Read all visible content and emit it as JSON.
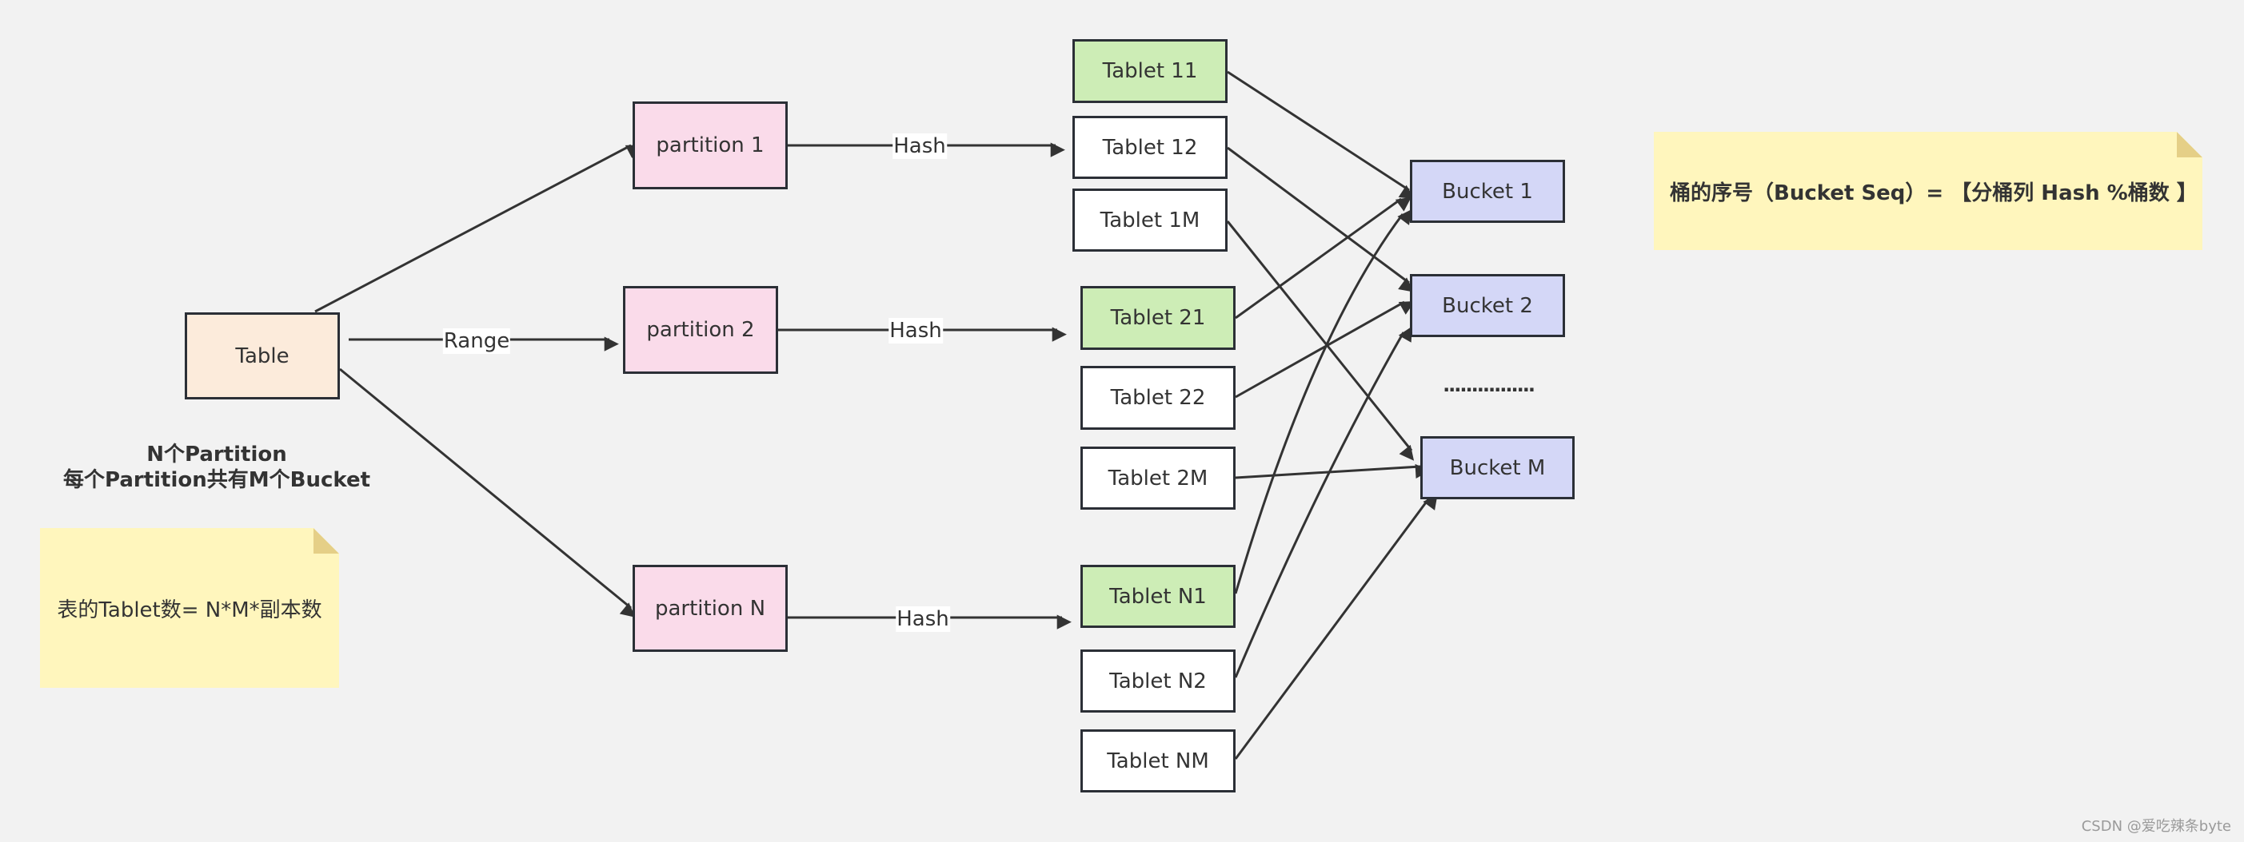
{
  "diagram": {
    "nodes": {
      "table": {
        "label": "Table",
        "kind": "table"
      },
      "partition_1": {
        "label": "partition 1",
        "kind": "partition"
      },
      "partition_2": {
        "label": "partition 2",
        "kind": "partition"
      },
      "partition_n": {
        "label": "partition N",
        "kind": "partition"
      },
      "tablet_11": {
        "label": "Tablet 11",
        "kind": "tablet",
        "primary": true
      },
      "tablet_12": {
        "label": "Tablet 12",
        "kind": "tablet",
        "primary": false
      },
      "tablet_1m": {
        "label": "Tablet 1M",
        "kind": "tablet",
        "primary": false
      },
      "tablet_21": {
        "label": "Tablet 21",
        "kind": "tablet",
        "primary": true
      },
      "tablet_22": {
        "label": "Tablet 22",
        "kind": "tablet",
        "primary": false
      },
      "tablet_2m": {
        "label": "Tablet 2M",
        "kind": "tablet",
        "primary": false
      },
      "tablet_n1": {
        "label": "Tablet N1",
        "kind": "tablet",
        "primary": true
      },
      "tablet_n2": {
        "label": "Tablet N2",
        "kind": "tablet",
        "primary": false
      },
      "tablet_nm": {
        "label": "Tablet NM",
        "kind": "tablet",
        "primary": false
      },
      "bucket_1": {
        "label": "Bucket 1",
        "kind": "bucket"
      },
      "bucket_2": {
        "label": "Bucket 2",
        "kind": "bucket"
      },
      "bucket_m": {
        "label": "Bucket M",
        "kind": "bucket"
      }
    },
    "edges": [
      {
        "from": "table",
        "to": "partition_1",
        "label": ""
      },
      {
        "from": "table",
        "to": "partition_2",
        "label": "Range"
      },
      {
        "from": "table",
        "to": "partition_n",
        "label": ""
      },
      {
        "from": "partition_1",
        "to": "tablets_1",
        "label": "Hash"
      },
      {
        "from": "partition_2",
        "to": "tablets_2",
        "label": "Hash"
      },
      {
        "from": "partition_n",
        "to": "tablets_n",
        "label": "Hash"
      },
      {
        "from": "tablet_11",
        "to": "bucket_1",
        "label": ""
      },
      {
        "from": "tablet_12",
        "to": "bucket_2",
        "label": ""
      },
      {
        "from": "tablet_1m",
        "to": "bucket_m",
        "label": ""
      },
      {
        "from": "tablet_21",
        "to": "bucket_1",
        "label": ""
      },
      {
        "from": "tablet_22",
        "to": "bucket_2",
        "label": ""
      },
      {
        "from": "tablet_2m",
        "to": "bucket_m",
        "label": ""
      },
      {
        "from": "tablet_n1",
        "to": "bucket_1",
        "label": ""
      },
      {
        "from": "tablet_n2",
        "to": "bucket_2",
        "label": ""
      },
      {
        "from": "tablet_nm",
        "to": "bucket_m",
        "label": ""
      }
    ],
    "edge_labels": {
      "range": "Range",
      "hash_1": "Hash",
      "hash_2": "Hash",
      "hash_n": "Hash"
    },
    "bucket_ellipsis": "................",
    "caption": {
      "line1": "N个Partition",
      "line2": "每个Partition共有M个Bucket"
    },
    "notes": {
      "tablet_count": "表的Tablet数= N*M*副本数",
      "bucket_seq": "桶的序号（Bucket Seq）= 【分桶列 Hash %桶数 】"
    }
  },
  "colors": {
    "background": "#f2f2f2",
    "table_fill": "#fcebdb",
    "partition_fill": "#fadbea",
    "tablet_primary_fill": "#cdedb6",
    "tablet_fill": "#ffffff",
    "bucket_fill": "#d4d7f7",
    "note_fill": "#fff6bd",
    "stroke": "#2b2f36"
  },
  "watermark": "CSDN @爱吃辣条byte"
}
